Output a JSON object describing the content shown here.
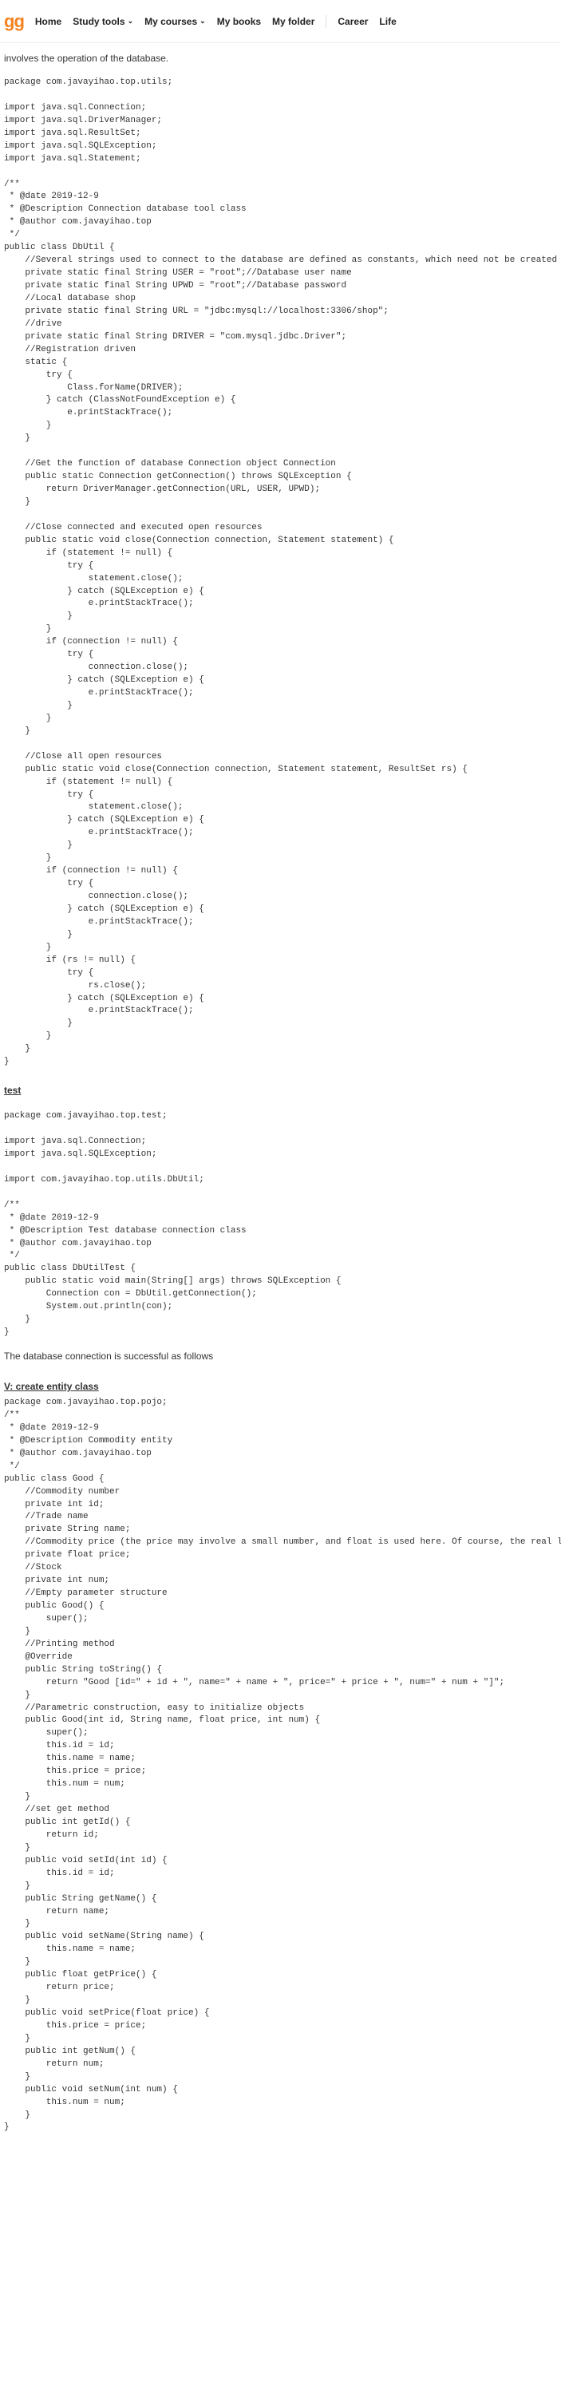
{
  "header": {
    "logo": "gg",
    "nav": [
      "Home",
      "Study tools",
      "My courses",
      "My books",
      "My folder",
      "Career",
      "Life"
    ]
  },
  "intro": "involves the operation of the database.",
  "code1": "package com.javayihao.top.utils;\n\nimport java.sql.Connection;\nimport java.sql.DriverManager;\nimport java.sql.ResultSet;\nimport java.sql.SQLException;\nimport java.sql.Statement;\n\n/**\n * @date 2019-12-9\n * @Description Connection database tool class\n * @author com.javayihao.top\n */\npublic class DbUtil {\n    //Several strings used to connect to the database are defined as constants, which need not be created every time\n    private static final String USER = \"root\";//Database user name\n    private static final String UPWD = \"root\";//Database password\n    //Local database shop\n    private static final String URL = \"jdbc:mysql://localhost:3306/shop\";\n    //drive\n    private static final String DRIVER = \"com.mysql.jdbc.Driver\";\n    //Registration driven\n    static {\n        try {\n            Class.forName(DRIVER);\n        } catch (ClassNotFoundException e) {\n            e.printStackTrace();\n        }\n    }\n\n    //Get the function of database Connection object Connection\n    public static Connection getConnection() throws SQLException {\n        return DriverManager.getConnection(URL, USER, UPWD);\n    }\n\n    //Close connected and executed open resources\n    public static void close(Connection connection, Statement statement) {\n        if (statement != null) {\n            try {\n                statement.close();\n            } catch (SQLException e) {\n                e.printStackTrace();\n            }\n        }\n        if (connection != null) {\n            try {\n                connection.close();\n            } catch (SQLException e) {\n                e.printStackTrace();\n            }\n        }\n    }\n\n    //Close all open resources\n    public static void close(Connection connection, Statement statement, ResultSet rs) {\n        if (statement != null) {\n            try {\n                statement.close();\n            } catch (SQLException e) {\n                e.printStackTrace();\n            }\n        }\n        if (connection != null) {\n            try {\n                connection.close();\n            } catch (SQLException e) {\n                e.printStackTrace();\n            }\n        }\n        if (rs != null) {\n            try {\n                rs.close();\n            } catch (SQLException e) {\n                e.printStackTrace();\n            }\n        }\n    }\n}",
  "test_header": "test",
  "code2": "package com.javayihao.top.test;\n\nimport java.sql.Connection;\nimport java.sql.SQLException;\n\nimport com.javayihao.top.utils.DbUtil;\n\n/**\n * @date 2019-12-9\n * @Description Test database connection class\n * @author com.javayihao.top\n */\npublic class DbUtilTest {\n    public static void main(String[] args) throws SQLException {\n        Connection con = DbUtil.getConnection();\n        System.out.println(con);\n    }\n}",
  "db_success": "The database connection is successful as follows",
  "entity_header": "V: create entity class",
  "code3": "package com.javayihao.top.pojo;\n/**\n * @date 2019-12-9\n * @Description Commodity entity\n * @author com.javayihao.top\n */\npublic class Good {\n    //Commodity number\n    private int id;\n    //Trade name\n    private String name;\n    //Commodity price (the price may involve a small number, and float is used here. Of course, the real large shopping platform will not use float, and interested friends can learn about it online)\n    private float price;\n    //Stock\n    private int num;\n    //Empty parameter structure\n    public Good() {\n        super();\n    }\n    //Printing method\n    @Override\n    public String toString() {\n        return \"Good [id=\" + id + \", name=\" + name + \", price=\" + price + \", num=\" + num + \"]\";\n    }\n    //Parametric construction, easy to initialize objects\n    public Good(int id, String name, float price, int num) {\n        super();\n        this.id = id;\n        this.name = name;\n        this.price = price;\n        this.num = num;\n    }\n    //set get method\n    public int getId() {\n        return id;\n    }\n    public void setId(int id) {\n        this.id = id;\n    }\n    public String getName() {\n        return name;\n    }\n    public void setName(String name) {\n        this.name = name;\n    }\n    public float getPrice() {\n        return price;\n    }\n    public void setPrice(float price) {\n        this.price = price;\n    }\n    public int getNum() {\n        return num;\n    }\n    public void setNum(int num) {\n        this.num = num;\n    }\n}"
}
